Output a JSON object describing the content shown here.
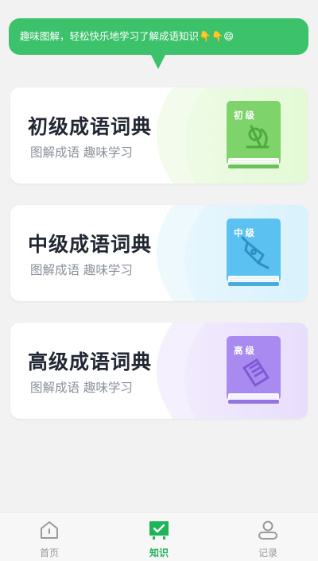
{
  "colors": {
    "accent": "#3cc26a",
    "title_text": "#222833",
    "subtitle_text": "#8a8f99",
    "tab_inactive": "#9a9a9a",
    "tab_active": "#1fb45a"
  },
  "bubble": {
    "text": "趣味图解，轻松快乐地学习了解成语知识👇👇😄"
  },
  "cards": [
    {
      "title": "初级成语词典",
      "subtitle": "图解成语 趣味学习",
      "book_label": "初级",
      "book_icon": "microscope-icon",
      "color": "#7ed36a"
    },
    {
      "title": "中级成语词典",
      "subtitle": "图解成语 趣味学习",
      "book_label": "中级",
      "book_icon": "pen-nib-icon",
      "color": "#5bc1f0"
    },
    {
      "title": "高级成语词典",
      "subtitle": "图解成语 趣味学习",
      "book_label": "高级",
      "book_icon": "notepad-icon",
      "color": "#a98af0"
    }
  ],
  "tabbar": {
    "items": [
      {
        "label": "首页",
        "icon": "home-icon",
        "active": false
      },
      {
        "label": "知识",
        "icon": "knowledge-icon",
        "active": true
      },
      {
        "label": "记录",
        "icon": "user-icon",
        "active": false
      }
    ]
  }
}
